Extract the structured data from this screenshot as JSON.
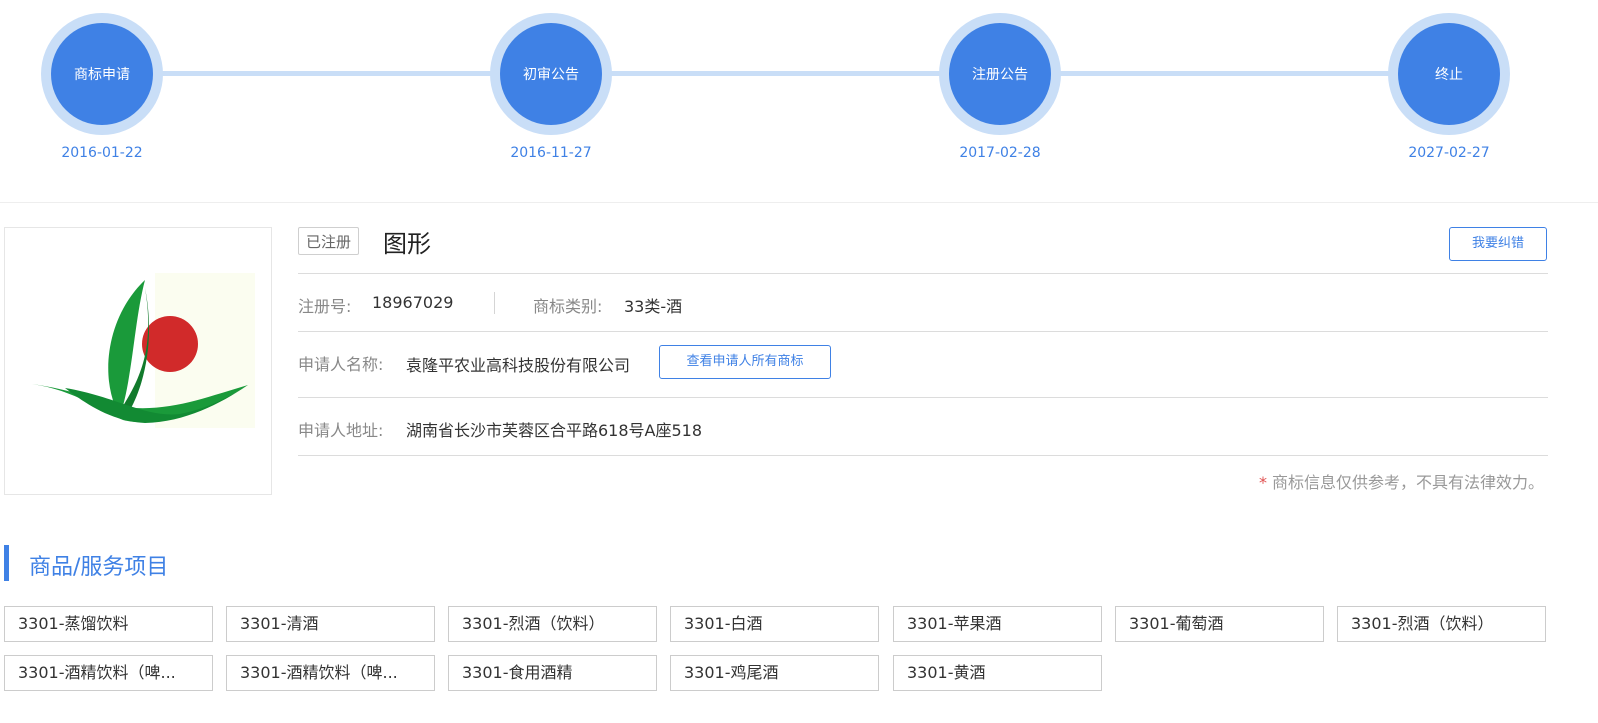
{
  "timeline": [
    {
      "label": "商标申请",
      "date": "2016-01-22"
    },
    {
      "label": "初审公告",
      "date": "2016-11-27"
    },
    {
      "label": "注册公告",
      "date": "2017-02-28"
    },
    {
      "label": "终止",
      "date": "2027-02-27"
    }
  ],
  "trademark": {
    "status": "已注册",
    "name": "图形",
    "correct_button": "我要纠错",
    "reg_no_label": "注册号:",
    "reg_no": "18967029",
    "class_label": "商标类别:",
    "class_value": "33类-酒",
    "applicant_label": "申请人名称:",
    "applicant": "袁隆平农业高科技股份有限公司",
    "view_all_button": "查看申请人所有商标",
    "address_label": "申请人地址:",
    "address": "湖南省长沙市芙蓉区合平路618号A座518",
    "disclaimer_star": "*",
    "disclaimer": "商标信息仅供参考，不具有法律效力。"
  },
  "goods": {
    "title": "商品/服务项目",
    "items": [
      "3301-蒸馏饮料",
      "3301-清酒",
      "3301-烈酒（饮料）",
      "3301-白酒",
      "3301-苹果酒",
      "3301-葡萄酒",
      "3301-烈酒（饮料）",
      "3301-酒精饮料（啤...",
      "3301-酒精饮料（啤...",
      "3301-食用酒精",
      "3301-鸡尾酒",
      "3301-黄酒"
    ]
  }
}
